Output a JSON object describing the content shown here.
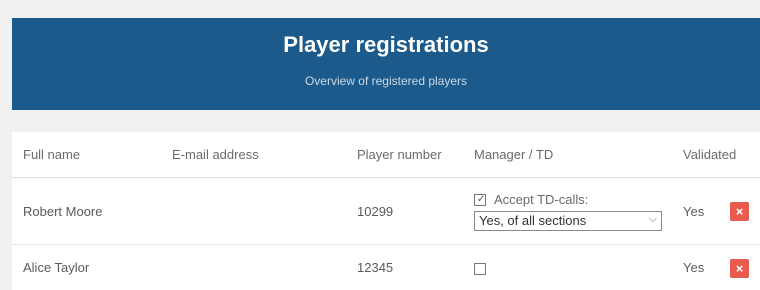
{
  "header": {
    "title": "Player registrations",
    "subtitle": "Overview of registered players"
  },
  "table": {
    "columns": {
      "full_name": "Full name",
      "email": "E-mail address",
      "player_number": "Player number",
      "manager_td": "Manager / TD",
      "validated": "Validated"
    },
    "rows": [
      {
        "full_name": "Robert Moore",
        "email": "",
        "player_number": "10299",
        "accept_td_checked": true,
        "accept_td_label": "Accept TD-calls:",
        "td_sections_selected": "Yes, of all sections",
        "validated": "Yes",
        "delete_icon": "×"
      },
      {
        "full_name": "Alice Taylor",
        "email": "",
        "player_number": "12345",
        "accept_td_checked": false,
        "validated": "Yes",
        "delete_icon": "×"
      }
    ]
  },
  "colors": {
    "header_bg": "#1b5a8a",
    "delete_button": "#ea5a4e"
  },
  "icons": {
    "checkbox_checked": "✓",
    "select_chevron": "⌵"
  }
}
